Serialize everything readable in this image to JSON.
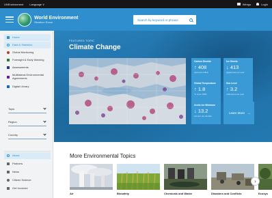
{
  "topbar": {
    "site_link": "UNEnvironment",
    "language": "Language ∨",
    "wiregs": "Wiregs",
    "login": "Login"
  },
  "header": {
    "logo_title": "World Environment",
    "logo_subtitle": "Situation Room",
    "search_placeholder": "Search by keyword or phrase"
  },
  "sidebar": {
    "nav": [
      {
        "label": "Home",
        "icon": "home-icon"
      },
      {
        "label": "Data & Statistics",
        "icon": "chart-icon"
      },
      {
        "label": "Global Monitoring",
        "icon": "globe-icon"
      },
      {
        "label": "Foresight & Early Warning",
        "icon": "warning-icon"
      },
      {
        "label": "Assessments",
        "icon": "document-icon"
      },
      {
        "label": "Multilateral Environmental Agreements",
        "icon": "agreement-icon"
      },
      {
        "label": "Digital Library",
        "icon": "library-icon"
      }
    ],
    "filters": [
      {
        "label": "Topic"
      },
      {
        "label": "Region"
      },
      {
        "label": "Country"
      }
    ],
    "footer_nav": [
      {
        "label": "About",
        "icon": "info-icon"
      },
      {
        "label": "Partners",
        "icon": "partners-icon"
      },
      {
        "label": "News",
        "icon": "news-icon"
      },
      {
        "label": "Citizen Science",
        "icon": "citizen-icon"
      },
      {
        "label": "Get Involved",
        "icon": "involved-icon"
      }
    ]
  },
  "hero": {
    "subtitle": "FEATURED TOPIC",
    "title": "Climate Change",
    "stats": [
      {
        "label": "Carbon Dioxide",
        "value": "↑ 408",
        "unit": "parts per million"
      },
      {
        "label": "Ice Sheets",
        "value": "↓ 413",
        "unit": "gigatonnes per year"
      },
      {
        "label": "Global Temperature",
        "value": "↑ 1.8",
        "unit": "°F since 1880"
      },
      {
        "label": "Sea Level",
        "value": "↑ 3.2",
        "unit": "millimeters per year"
      },
      {
        "label": "Arctic Ice Minimum",
        "value": "↓ 13.2",
        "unit": "percent per decade"
      }
    ],
    "learn_more": "Learn More",
    "learn_more_arrow": "→"
  },
  "more_topics": {
    "title": "More Environmental Topics",
    "items": [
      {
        "label": "Air"
      },
      {
        "label": "Biosafety"
      },
      {
        "label": "Chemicals and Waste"
      },
      {
        "label": "Disasters and Conflicts"
      },
      {
        "label": "Ecosys"
      }
    ],
    "next_arrow": "›"
  },
  "colors": {
    "header_blue": "#2f8fce",
    "hero_blue": "#2379b1",
    "stat_blue": "#3a9ad6",
    "active_nav_bg": "#d9ebf7",
    "topbar": "#161616"
  }
}
